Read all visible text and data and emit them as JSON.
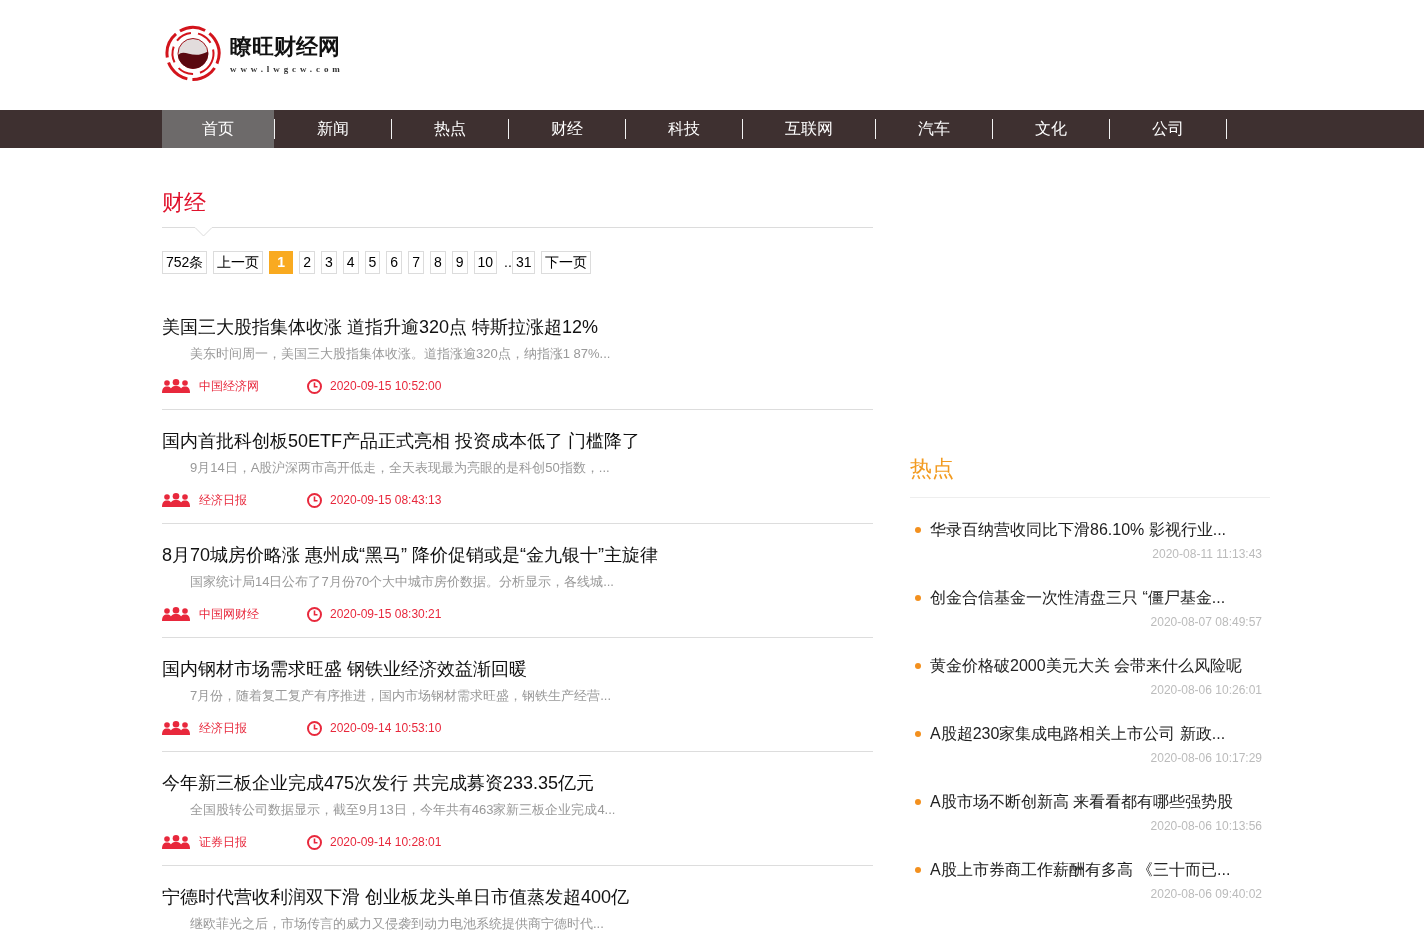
{
  "logo": {
    "name": "瞭旺财经网",
    "domain": "www.lwgcw.com"
  },
  "nav": [
    {
      "label": "首页",
      "selected": true
    },
    {
      "label": "新闻",
      "selected": false
    },
    {
      "label": "热点",
      "selected": false
    },
    {
      "label": "财经",
      "selected": false
    },
    {
      "label": "科技",
      "selected": false
    },
    {
      "label": "互联网",
      "selected": false
    },
    {
      "label": "汽车",
      "selected": false
    },
    {
      "label": "文化",
      "selected": false
    },
    {
      "label": "公司",
      "selected": false
    }
  ],
  "section": {
    "title": "财经"
  },
  "pagination": {
    "count": "752条",
    "prev": "上一页",
    "pages": [
      {
        "label": "1",
        "selected": true
      },
      {
        "label": "2",
        "selected": false
      },
      {
        "label": "3",
        "selected": false
      },
      {
        "label": "4",
        "selected": false
      },
      {
        "label": "5",
        "selected": false
      },
      {
        "label": "6",
        "selected": false
      },
      {
        "label": "7",
        "selected": false
      },
      {
        "label": "8",
        "selected": false
      },
      {
        "label": "9",
        "selected": false
      },
      {
        "label": "10",
        "selected": false
      }
    ],
    "ellipsis": "..",
    "last_page": {
      "label": "31",
      "selected": false
    },
    "next": "下一页"
  },
  "articles": [
    {
      "title": "美国三大股指集体收涨 道指升逾320点 特斯拉涨超12%",
      "summary": "美东时间周一，美国三大股指集体收涨。道指涨逾320点，纳指涨1 87%...",
      "source": "中国经济网",
      "time": "2020-09-15 10:52:00"
    },
    {
      "title": "国内首批科创板50ETF产品正式亮相 投资成本低了 门槛降了",
      "summary": "9月14日，A股沪深两市高开低走，全天表现最为亮眼的是科创50指数，...",
      "source": "经济日报",
      "time": "2020-09-15 08:43:13"
    },
    {
      "title": "8月70城房价略涨 惠州成“黑马” 降价促销或是“金九银十”主旋律",
      "summary": "国家统计局14日公布了7月份70个大中城市房价数据。分析显示，各线城...",
      "source": "中国网财经",
      "time": "2020-09-15 08:30:21"
    },
    {
      "title": "国内钢材市场需求旺盛 钢铁业经济效益渐回暖",
      "summary": "7月份，随着复工复产有序推进，国内市场钢材需求旺盛，钢铁生产经营...",
      "source": "经济日报",
      "time": "2020-09-14 10:53:10"
    },
    {
      "title": "今年新三板企业完成475次发行 共完成募资233.35亿元",
      "summary": "全国股转公司数据显示，截至9月13日，今年共有463家新三板企业完成4...",
      "source": "证券日报",
      "time": "2020-09-14 10:28:01"
    },
    {
      "title": "宁德时代营收利润双下滑 创业板龙头单日市值蒸发超400亿",
      "summary": "继欧菲光之后，市场传言的威力又侵袭到动力电池系统提供商宁德时代..."
    }
  ],
  "hot": {
    "title": "热点",
    "items": [
      {
        "title": "华录百纳营收同比下滑86.10% 影视行业...",
        "time": "2020-08-11 11:13:43"
      },
      {
        "title": "创金合信基金一次性清盘三只 “僵尸基金...",
        "time": "2020-08-07 08:49:57"
      },
      {
        "title": "黄金价格破2000美元大关 会带来什么风险呢",
        "time": "2020-08-06 10:26:01"
      },
      {
        "title": "A股超230家集成电路相关上市公司 新政...",
        "time": "2020-08-06 10:17:29"
      },
      {
        "title": "A股市场不断创新高 来看看都有哪些强势股",
        "time": "2020-08-06 10:13:56"
      },
      {
        "title": "A股上市券商工作薪酬有多高 《三十而已...",
        "time": "2020-08-06 09:40:02"
      }
    ]
  }
}
